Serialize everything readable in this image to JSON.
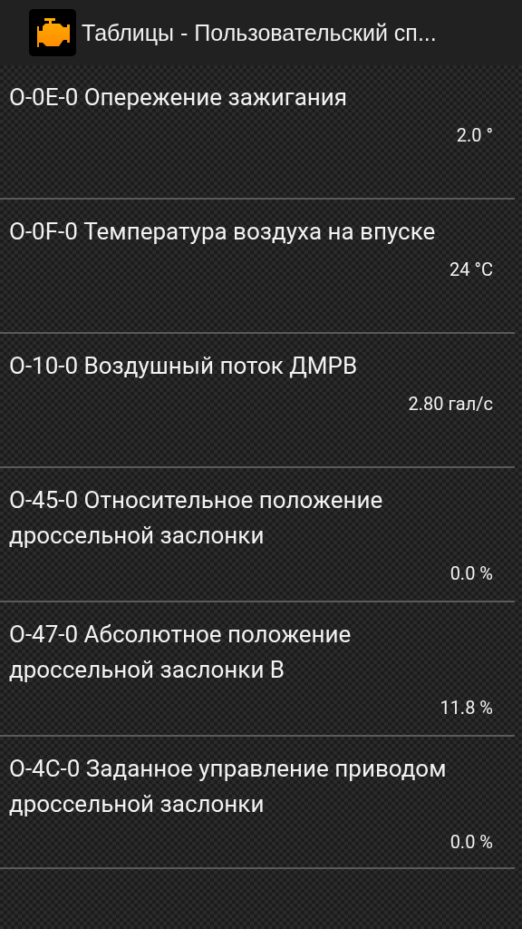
{
  "action_bar": {
    "title": "Таблицы - Пользовательский сп..."
  },
  "readings": [
    {
      "name": "O-0E-0 Опережение зажигания",
      "value": "2.0 °"
    },
    {
      "name": "O-0F-0 Температура воздуха на впуске",
      "value": "24 °C"
    },
    {
      "name": "O-10-0 Воздушный поток ДМРВ",
      "value": "2.80 гал/с"
    },
    {
      "name": "O-45-0 Относительное положение дроссельной заслонки",
      "value": "0.0 %"
    },
    {
      "name": "O-47-0 Абсолютное положение дроссельной заслонки B",
      "value": "11.8 %"
    },
    {
      "name": "O-4C-0 Заданное управление приводом дроссельной заслонки",
      "value": "0.0 %"
    }
  ]
}
